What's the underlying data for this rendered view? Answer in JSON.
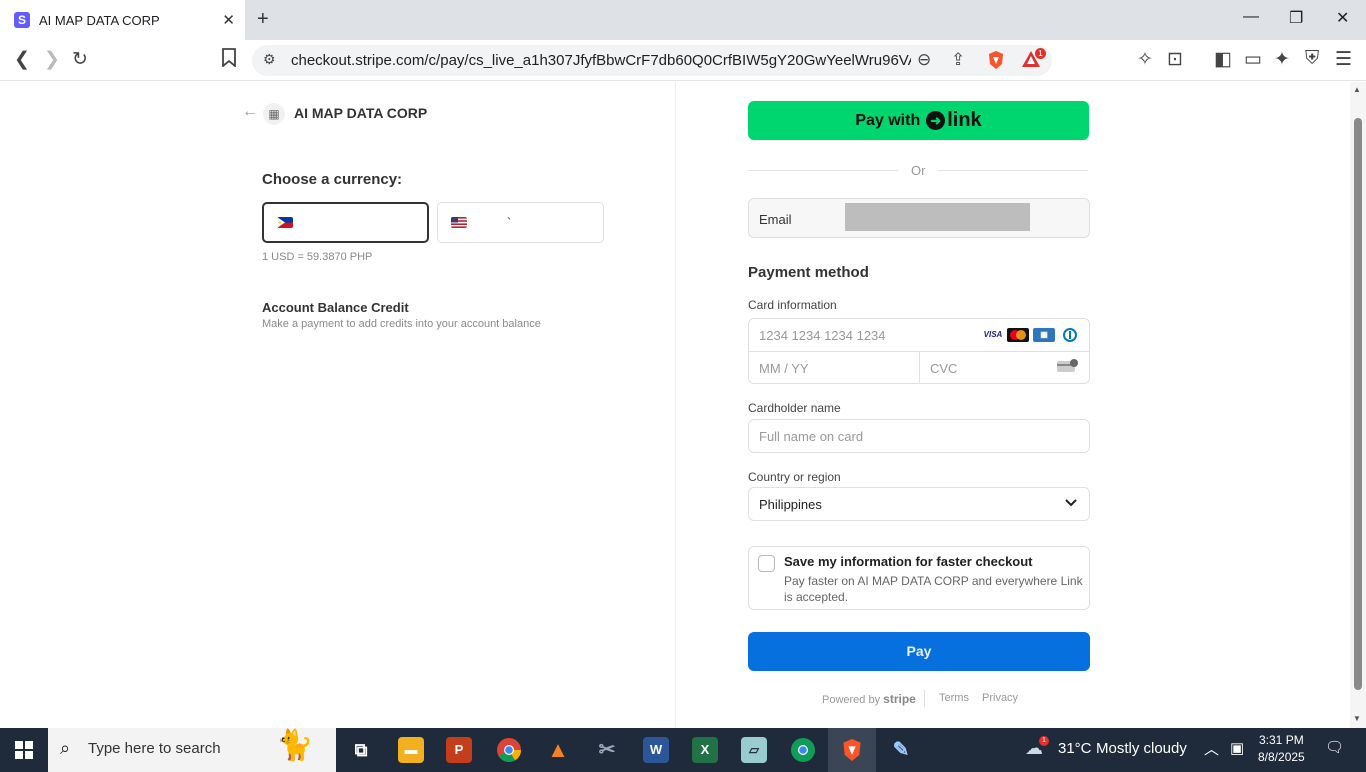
{
  "browser": {
    "tab_title": "AI MAP DATA CORP",
    "tab_favicon": "S",
    "url": "checkout.stripe.com/c/pay/cs_live_a1h307JfyfBbwCrF7db60Q0CrfBIW5gY20GwYeelWru96VAtugzc...",
    "brave_badge": "1"
  },
  "merchant": {
    "name": "AI MAP DATA CORP"
  },
  "currency": {
    "heading": "Choose a currency:",
    "options": [
      {
        "flag": "philippines-flag",
        "label": "",
        "selected": true
      },
      {
        "flag": "us-flag",
        "label": "`",
        "selected": false
      }
    ],
    "rate": "1 USD = 59.3870 PHP"
  },
  "product": {
    "title": "Account Balance Credit",
    "description": "Make a payment to add credits into your account balance"
  },
  "checkout": {
    "link_button": {
      "prefix": "Pay with",
      "brand": "link"
    },
    "or_label": "Or",
    "email_label": "Email",
    "payment_method_title": "Payment method",
    "card_info_label": "Card information",
    "card_number_placeholder": "1234 1234 1234 1234",
    "expiry_placeholder": "MM / YY",
    "cvc_placeholder": "CVC",
    "card_brands": [
      "VISA",
      "mastercard",
      "amex",
      "diners"
    ],
    "cardholder_label": "Cardholder name",
    "cardholder_placeholder": "Full name on card",
    "country_label": "Country or region",
    "country_value": "Philippines",
    "save_title": "Save my information for faster checkout",
    "save_desc": "Pay faster on AI MAP DATA CORP and everywhere Link is accepted.",
    "pay_label": "Pay",
    "footer": {
      "powered_by": "Powered by",
      "stripe": "stripe",
      "terms": "Terms",
      "privacy": "Privacy"
    }
  },
  "taskbar": {
    "search_placeholder": "Type here to search",
    "weather_temp": "31°C",
    "weather_desc": "Mostly cloudy",
    "weather_badge": "1",
    "time": "3:31 PM",
    "date": "8/8/2025"
  },
  "colors": {
    "link_green": "#00d66f",
    "pay_blue": "#0570de",
    "stripe_purple": "#635bff"
  }
}
